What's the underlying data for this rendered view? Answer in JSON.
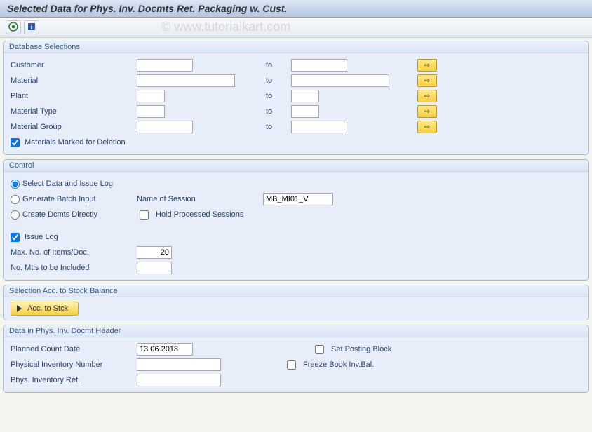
{
  "title": "Selected Data for Phys. Inv. Docmts Ret. Packaging w. Cust.",
  "watermark": "© www.tutorialkart.com",
  "db": {
    "heading": "Database Selections",
    "customer": {
      "label": "Customer",
      "from": "",
      "to_label": "to",
      "to": ""
    },
    "material": {
      "label": "Material",
      "from": "",
      "to_label": "to",
      "to": ""
    },
    "plant": {
      "label": "Plant",
      "from": "",
      "to_label": "to",
      "to": ""
    },
    "mat_type": {
      "label": "Material Type",
      "from": "",
      "to_label": "to",
      "to": ""
    },
    "mat_group": {
      "label": "Material Group",
      "from": "",
      "to_label": "to",
      "to": ""
    },
    "marked_del": "Materials Marked for Deletion"
  },
  "control": {
    "heading": "Control",
    "opt1": "Select Data and Issue Log",
    "opt2": "Generate Batch Input",
    "opt3": "Create Dcmts Directly",
    "session_label": "Name of Session",
    "session_value": "MB_MI01_V",
    "hold": "Hold Processed Sessions",
    "issue_log": "Issue Log",
    "max_items": {
      "label": "Max. No. of Items/Doc.",
      "value": "20"
    },
    "no_mtls": {
      "label": "No. Mtls to be Included",
      "value": ""
    }
  },
  "stock": {
    "heading": "Selection Acc. to Stock Balance",
    "btn": "Acc. to Stck"
  },
  "header": {
    "heading": "Data in Phys. Inv. Docmt Header",
    "planned": {
      "label": "Planned Count Date",
      "value": "13.06.2018"
    },
    "pinum": {
      "label": "Physical Inventory Number",
      "value": ""
    },
    "piref": {
      "label": "Phys. Inventory Ref.",
      "value": ""
    },
    "set_posting": "Set Posting Block",
    "freeze": "Freeze Book Inv.Bal."
  }
}
